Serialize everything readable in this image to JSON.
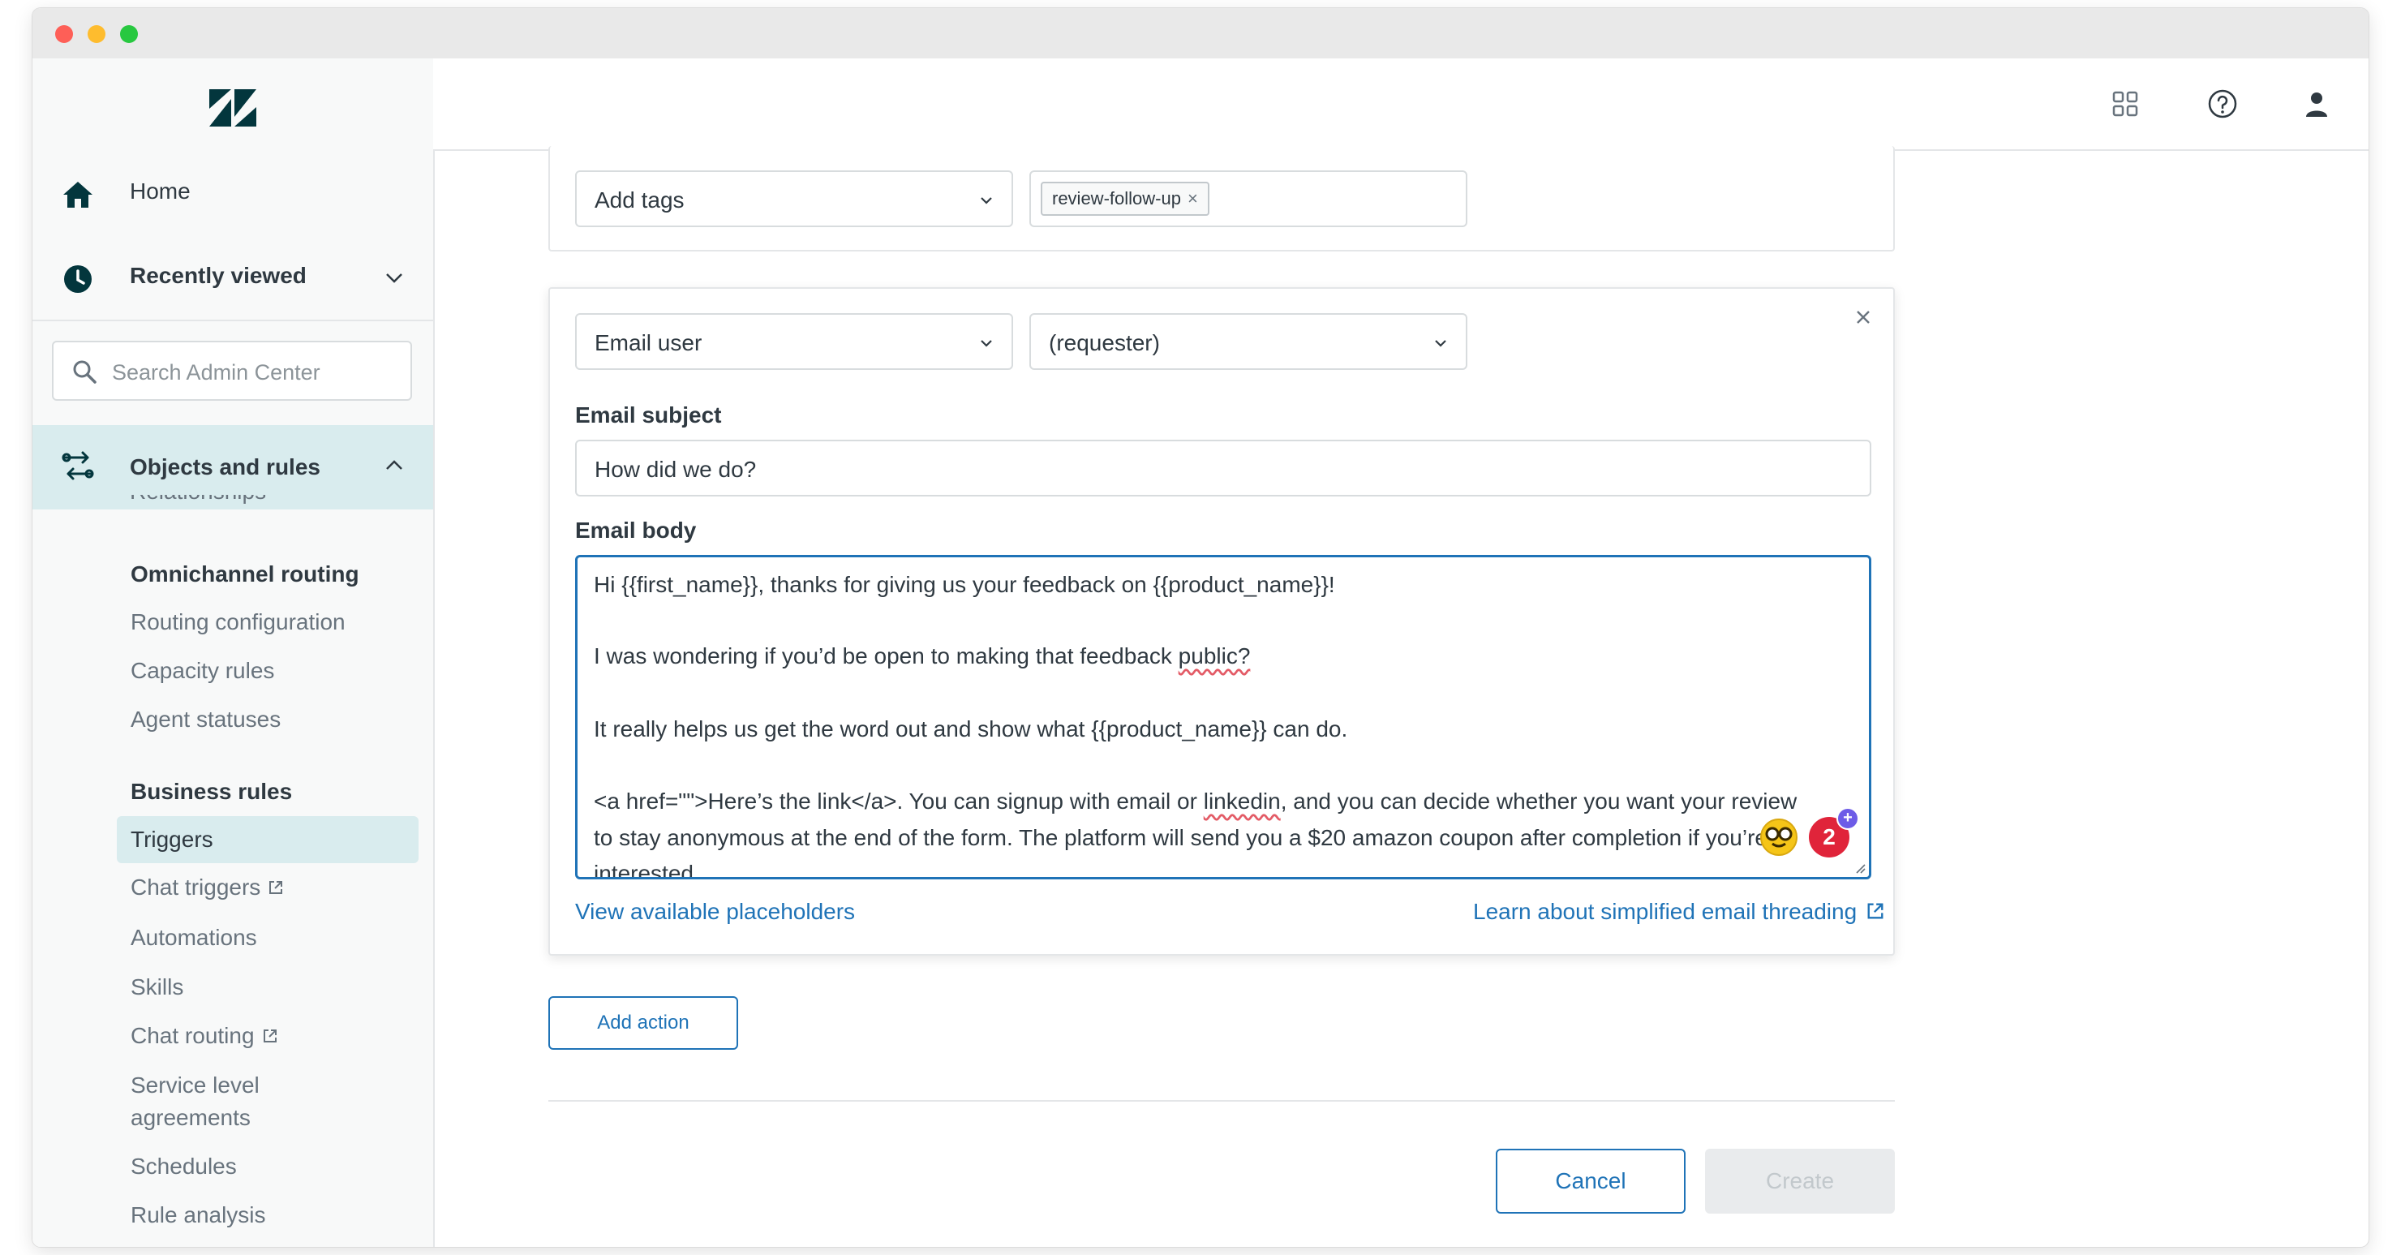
{
  "sidebar": {
    "home_label": "Home",
    "recent_label": "Recently viewed",
    "search_placeholder": "Search Admin Center",
    "section_label": "Objects and rules",
    "cutoff_item": "Relationships",
    "groups": [
      {
        "heading": "Omnichannel routing",
        "items": [
          "Routing configuration",
          "Capacity rules",
          "Agent statuses"
        ]
      },
      {
        "heading": "Business rules",
        "items": [
          "Triggers",
          "Chat triggers",
          "Automations",
          "Skills",
          "Chat routing",
          "Service level",
          "agreements",
          "Schedules",
          "Rule analysis"
        ]
      }
    ]
  },
  "actions": {
    "tags_action": "Add tags",
    "tag_value": "review-follow-up",
    "email_action": "Email user",
    "email_recipient": "(requester)",
    "subject_label": "Email subject",
    "subject_value": "How did we do?",
    "body_label": "Email body",
    "body_lines": [
      "Hi {{first_name}}, thanks for giving us your feedback on {{product_name}}!",
      "I was wondering if you’d be open to making that feedback ",
      "public?",
      "It really helps us get the word out and show what {{product_name}} can do.",
      "<a href=\"\">Here’s the link</a>. You can signup with email or ",
      "linkedin",
      ", and you can decide whether you want your review",
      "to stay anonymous at the end of the form. The platform will send you a $20 amazon coupon after completion if you’re",
      "interested"
    ],
    "placeholders_link": "View available placeholders",
    "threading_link": "Learn about simplified email threading",
    "badge_count": "2"
  },
  "buttons": {
    "add_action": "Add action",
    "cancel": "Cancel",
    "create": "Create"
  },
  "colors": {
    "accent": "#1f73b7",
    "active_bg": "#d9ecee",
    "badge": "#e0243a"
  }
}
